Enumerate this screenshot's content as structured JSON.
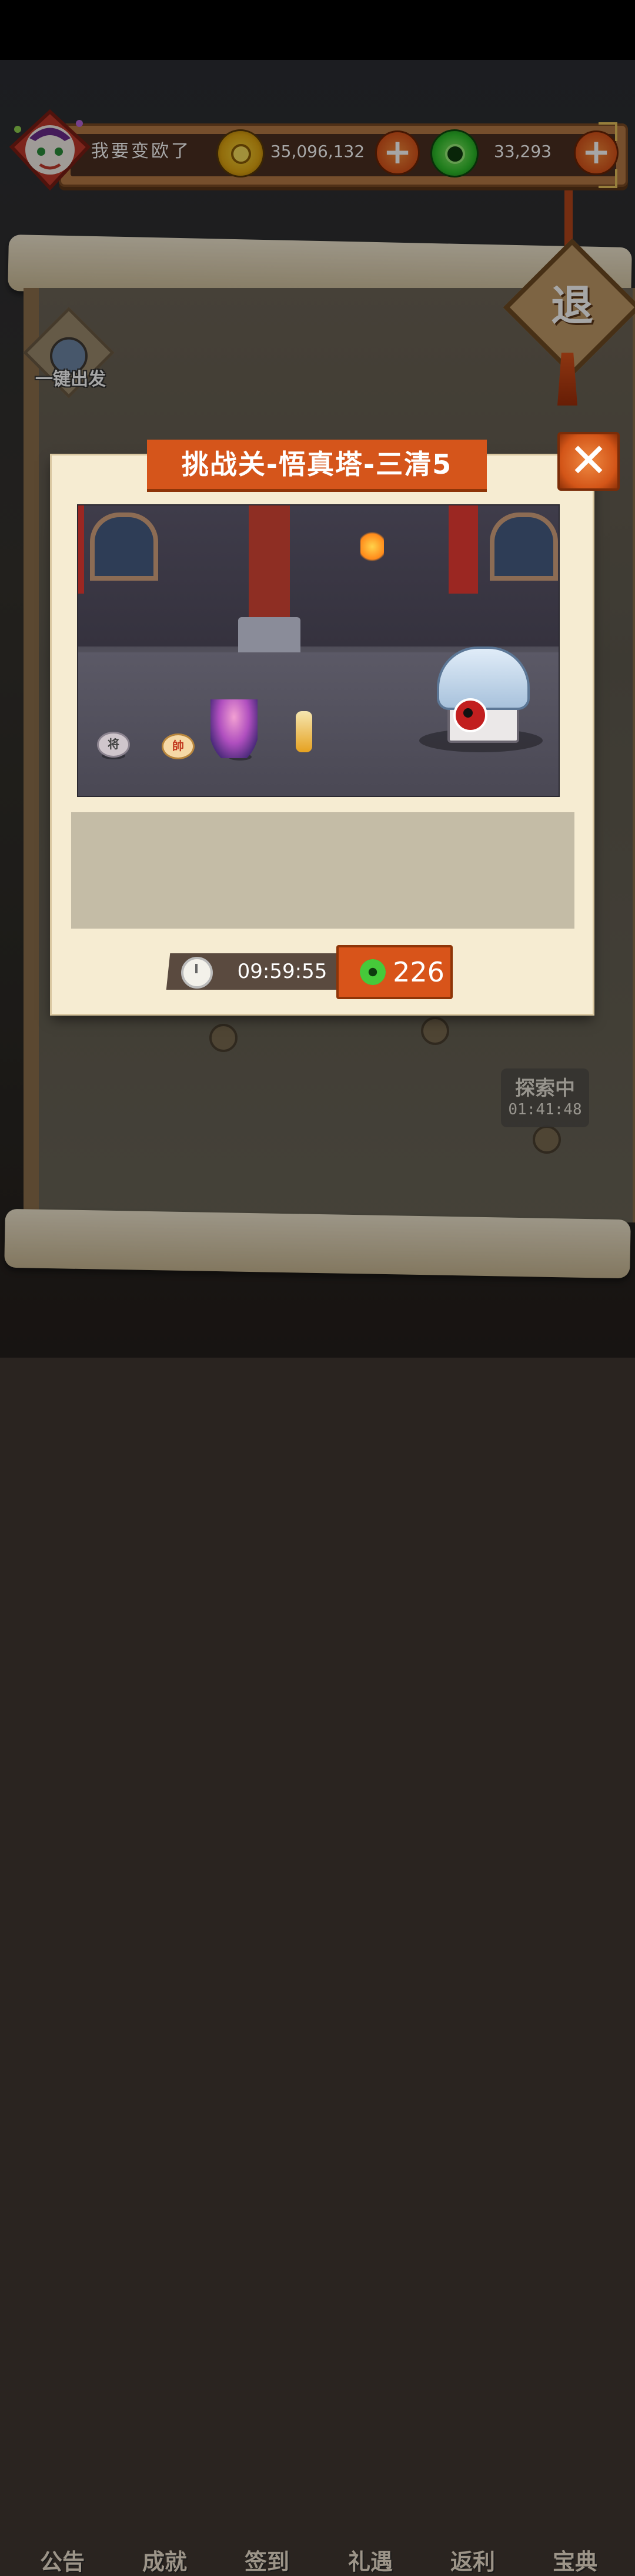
{
  "player": {
    "name": "我要变欧了"
  },
  "resources": {
    "gold": {
      "amount": "35,096,132",
      "icon": "gold-coin-icon"
    },
    "jade": {
      "amount": "33,293",
      "icon": "jade-coin-icon"
    }
  },
  "map": {
    "one_click_label": "一键出发",
    "retreat_label": "退",
    "explore": {
      "status": "探索中",
      "timer": "01:41:48"
    }
  },
  "nav": [
    {
      "label": "公告"
    },
    {
      "label": "成就"
    },
    {
      "label": "签到"
    },
    {
      "label": "礼遇"
    },
    {
      "label": "返利"
    },
    {
      "label": "宝典"
    }
  ],
  "dialog": {
    "title": "挑战关-悟真塔-三清5",
    "close_icon": "close-icon",
    "scene": {
      "piece_left": "将",
      "piece_right": "帥"
    },
    "timer": "09:59:55",
    "cost": "226"
  }
}
